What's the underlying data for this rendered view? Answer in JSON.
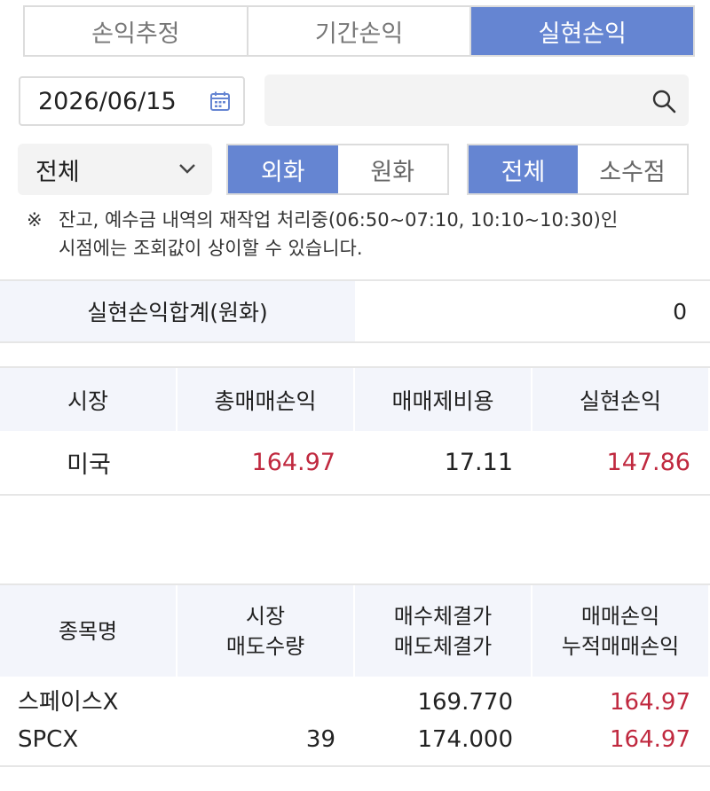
{
  "tabs": [
    {
      "label": "손익추정",
      "active": false
    },
    {
      "label": "기간손익",
      "active": false
    },
    {
      "label": "실현손익",
      "active": true
    }
  ],
  "date_field": {
    "value": "2026/06/15",
    "icon": "calendar-icon"
  },
  "search": {
    "value": "",
    "icon": "search-icon"
  },
  "filters": {
    "market_select": {
      "value": "전체",
      "icon": "chevron-down-icon"
    },
    "currency": [
      {
        "label": "외화",
        "active": true
      },
      {
        "label": "원화",
        "active": false
      }
    ],
    "decimal": [
      {
        "label": "전체",
        "active": true
      },
      {
        "label": "소수점",
        "active": false
      }
    ]
  },
  "notice": {
    "mark": "※",
    "line1": "잔고, 예수금 내역의 재작업 처리중(06:50~07:10, 10:10~10:30)인",
    "line2": "시점에는 조회값이 상이할 수 있습니다."
  },
  "summary": {
    "label": "실현손익합계(원화)",
    "value": "0"
  },
  "market_table": {
    "headers": [
      "시장",
      "총매매손익",
      "매매제비용",
      "실현손익"
    ],
    "rows": [
      {
        "market": "미국",
        "total_pl": "164.97",
        "fees": "17.11",
        "realized": "147.86"
      }
    ]
  },
  "stock_table": {
    "headers": {
      "c0": "종목명",
      "c1_top": "시장",
      "c1_bottom": "매도수량",
      "c2_top": "매수체결가",
      "c2_bottom": "매도체결가",
      "c3_top": "매매손익",
      "c3_bottom": "누적매매손익"
    },
    "rows": [
      {
        "name": "스페이스X",
        "ticker": "SPCX",
        "market": "",
        "sell_qty": "39",
        "buy_price": "169.770",
        "sell_price": "174.000",
        "trade_pl": "164.97",
        "cum_pl": "164.97"
      }
    ]
  },
  "colors": {
    "accent": "#6585d2",
    "loss_profit_red": "#c0293f",
    "header_bg": "#f3f5fb"
  }
}
